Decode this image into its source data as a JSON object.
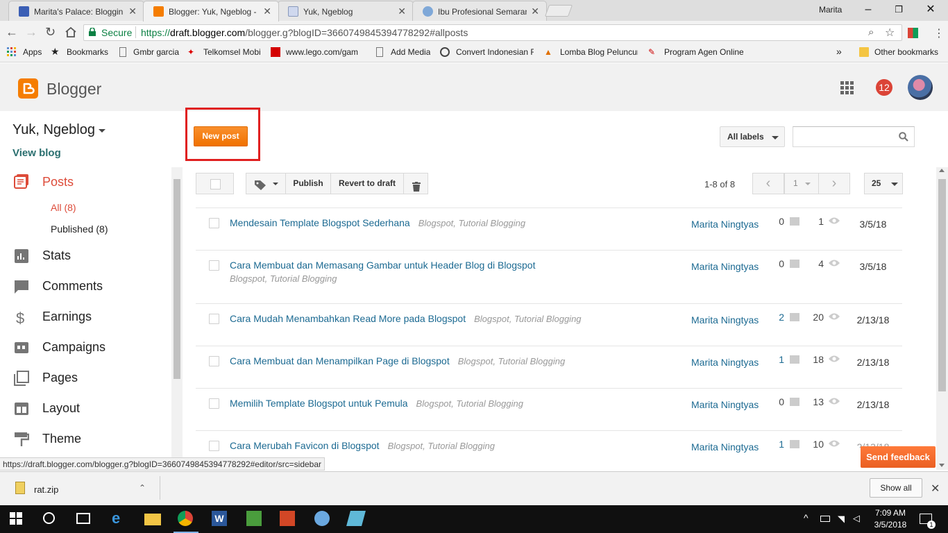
{
  "browser": {
    "tabs": [
      {
        "title": "Marita's Palace: Blogging",
        "icon": "blogger-favicon"
      },
      {
        "title": "Blogger: Yuk, Ngeblog - A",
        "icon": "blogger-favicon"
      },
      {
        "title": "Yuk, Ngeblog",
        "icon": "blog-favicon"
      },
      {
        "title": "Ibu Profesional Semarang",
        "icon": "globe-favicon"
      }
    ],
    "user": "Marita",
    "secure_label": "Secure",
    "url_scheme": "https://",
    "url_host": "draft.blogger.com",
    "url_path": "/blogger.g?blogID=3660749845394778292#allposts",
    "bookmarks": [
      "Apps",
      "Bookmarks",
      "Gmbr garcia",
      "Telkomsel Mobi",
      "www.lego.com/gam",
      "Add Media",
      "Convert Indonesian R",
      "Lomba Blog Peluncur",
      "Program Agen Online"
    ],
    "other_bookmarks": "Other bookmarks",
    "more_bookmarks": "»"
  },
  "blogger": {
    "brand": "Blogger",
    "notifications": "12",
    "blog_name": "Yuk, Ngeblog",
    "view_blog": "View blog",
    "nav": {
      "posts": "Posts",
      "all": "All (8)",
      "published": "Published (8)",
      "stats": "Stats",
      "comments": "Comments",
      "earnings": "Earnings",
      "campaigns": "Campaigns",
      "pages": "Pages",
      "layout": "Layout",
      "theme": "Theme"
    },
    "new_post": "New post",
    "all_labels": "All labels",
    "publish": "Publish",
    "revert": "Revert to draft",
    "page_info": "1-8 of 8",
    "page_num": "1",
    "per_page": "25",
    "posts": [
      {
        "title": "Mendesain Template Blogspot Sederhana",
        "label1": "Blogspot",
        "label2": "Tutorial Blogging",
        "author": "Marita Ningtyas",
        "comments": "0",
        "views": "1",
        "date": "3/5/18"
      },
      {
        "title": "Cara Membuat dan Memasang Gambar untuk Header Blog di Blogspot",
        "label1": "Blogspot",
        "label2": "Tutorial Blogging",
        "author": "Marita Ningtyas",
        "comments": "0",
        "views": "4",
        "date": "3/5/18"
      },
      {
        "title": "Cara Mudah Menambahkan Read More pada Blogspot",
        "label1": "Blogspot",
        "label2": "Tutorial Blogging",
        "author": "Marita Ningtyas",
        "comments": "2",
        "views": "20",
        "date": "2/13/18"
      },
      {
        "title": "Cara Membuat dan Menampilkan Page di Blogspot",
        "label1": "Blogspot",
        "label2": "Tutorial Blogging",
        "author": "Marita Ningtyas",
        "comments": "1",
        "views": "18",
        "date": "2/13/18"
      },
      {
        "title": "Memilih Template Blogspot untuk Pemula",
        "label1": "Blogspot",
        "label2": "Tutorial Blogging",
        "author": "Marita Ningtyas",
        "comments": "0",
        "views": "13",
        "date": "2/13/18"
      },
      {
        "title": "Cara Merubah Favicon di Blogspot",
        "label1": "Blogspot",
        "label2": "Tutorial Blogging",
        "author": "Marita Ningtyas",
        "comments": "1",
        "views": "10",
        "date": "2/13/18"
      }
    ],
    "send_feedback": "Send feedback"
  },
  "status_url": "https://draft.blogger.com/blogger.g?blogID=3660749845394778292#editor/src=sidebar",
  "download": {
    "file": "rat.zip",
    "show_all": "Show all"
  },
  "taskbar": {
    "time": "7:09 AM",
    "date": "3/5/2018",
    "notif_count": "1"
  },
  "colors": {
    "brand": "#f57d00",
    "link": "#1c6a92",
    "active_nav": "#dd4b39",
    "notif": "#db4437",
    "highlight": "#e02020"
  }
}
